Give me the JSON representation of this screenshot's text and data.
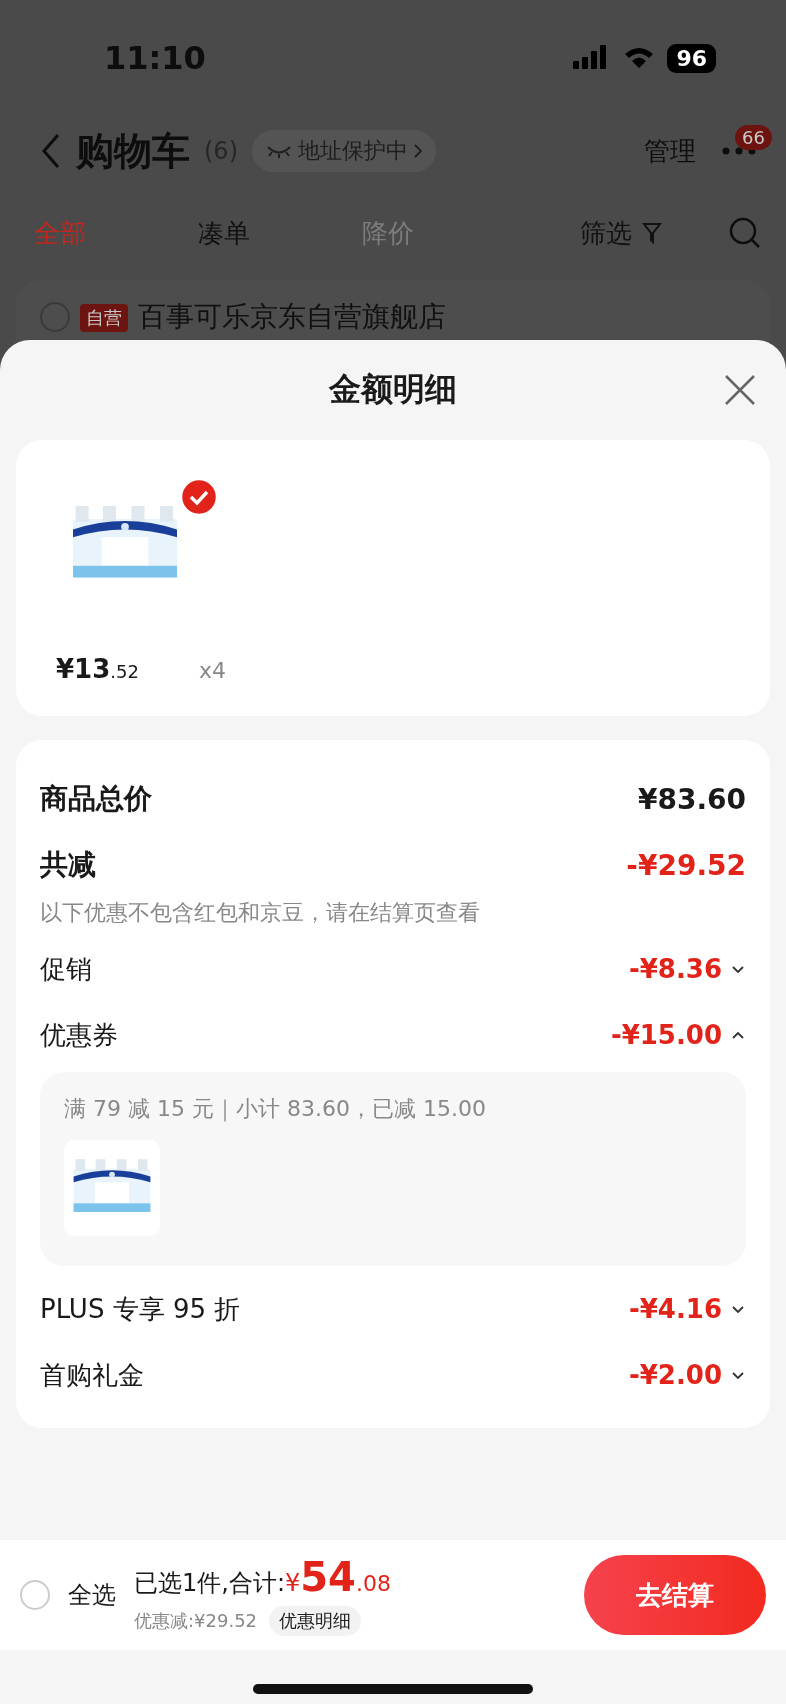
{
  "status_bar": {
    "time": "11:10",
    "battery": "96"
  },
  "header": {
    "title": "购物车",
    "count": "(6)",
    "address_badge": "地址保护中",
    "manage": "管理",
    "more_badge": "66"
  },
  "tabs": [
    {
      "label": "全部",
      "selected": true,
      "disabled": false
    },
    {
      "label": "凑单",
      "selected": false,
      "disabled": false
    },
    {
      "label": "降价",
      "selected": false,
      "disabled": true
    }
  ],
  "filter": {
    "label": "筛选"
  },
  "store": {
    "checked": false,
    "badge": "自营",
    "name": "百事可乐京东自营旗舰店"
  },
  "sheet": {
    "title": "金额明细",
    "items": [
      {
        "kind": "picture",
        "checked": true,
        "price_main": "¥13",
        "price_decimal": ".52",
        "quantity": "x4"
      }
    ],
    "summary": {
      "total_label": "商品总价",
      "total_value": "¥83.60",
      "reduction_label": "共减",
      "reduction_value": "-¥29.52",
      "note": "以下优惠不包含红包和京豆，请在结算页查看"
    },
    "discounts": [
      {
        "label": "促销",
        "amount": "-¥8.36",
        "expanded": false
      },
      {
        "label": "优惠券",
        "amount": "-¥15.00",
        "expanded": true,
        "detail": {
          "rule": "满 79 减 15 元｜小计 83.60，已减 15.00"
        }
      },
      {
        "label": "PLUS 专享 95 折",
        "amount": "-¥4.16",
        "expanded": false
      },
      {
        "label": "首购礼金",
        "amount": "-¥2.00",
        "expanded": false
      }
    ]
  },
  "bottom_bar": {
    "select_all": {
      "label": "全选",
      "checked": false
    },
    "selected_text": "已选1件,合计:",
    "currency": "¥",
    "total_main": "54",
    "total_decimal": ".08",
    "savings": "优惠减:¥29.52",
    "details_button": "优惠明细",
    "checkout": "去结算"
  }
}
